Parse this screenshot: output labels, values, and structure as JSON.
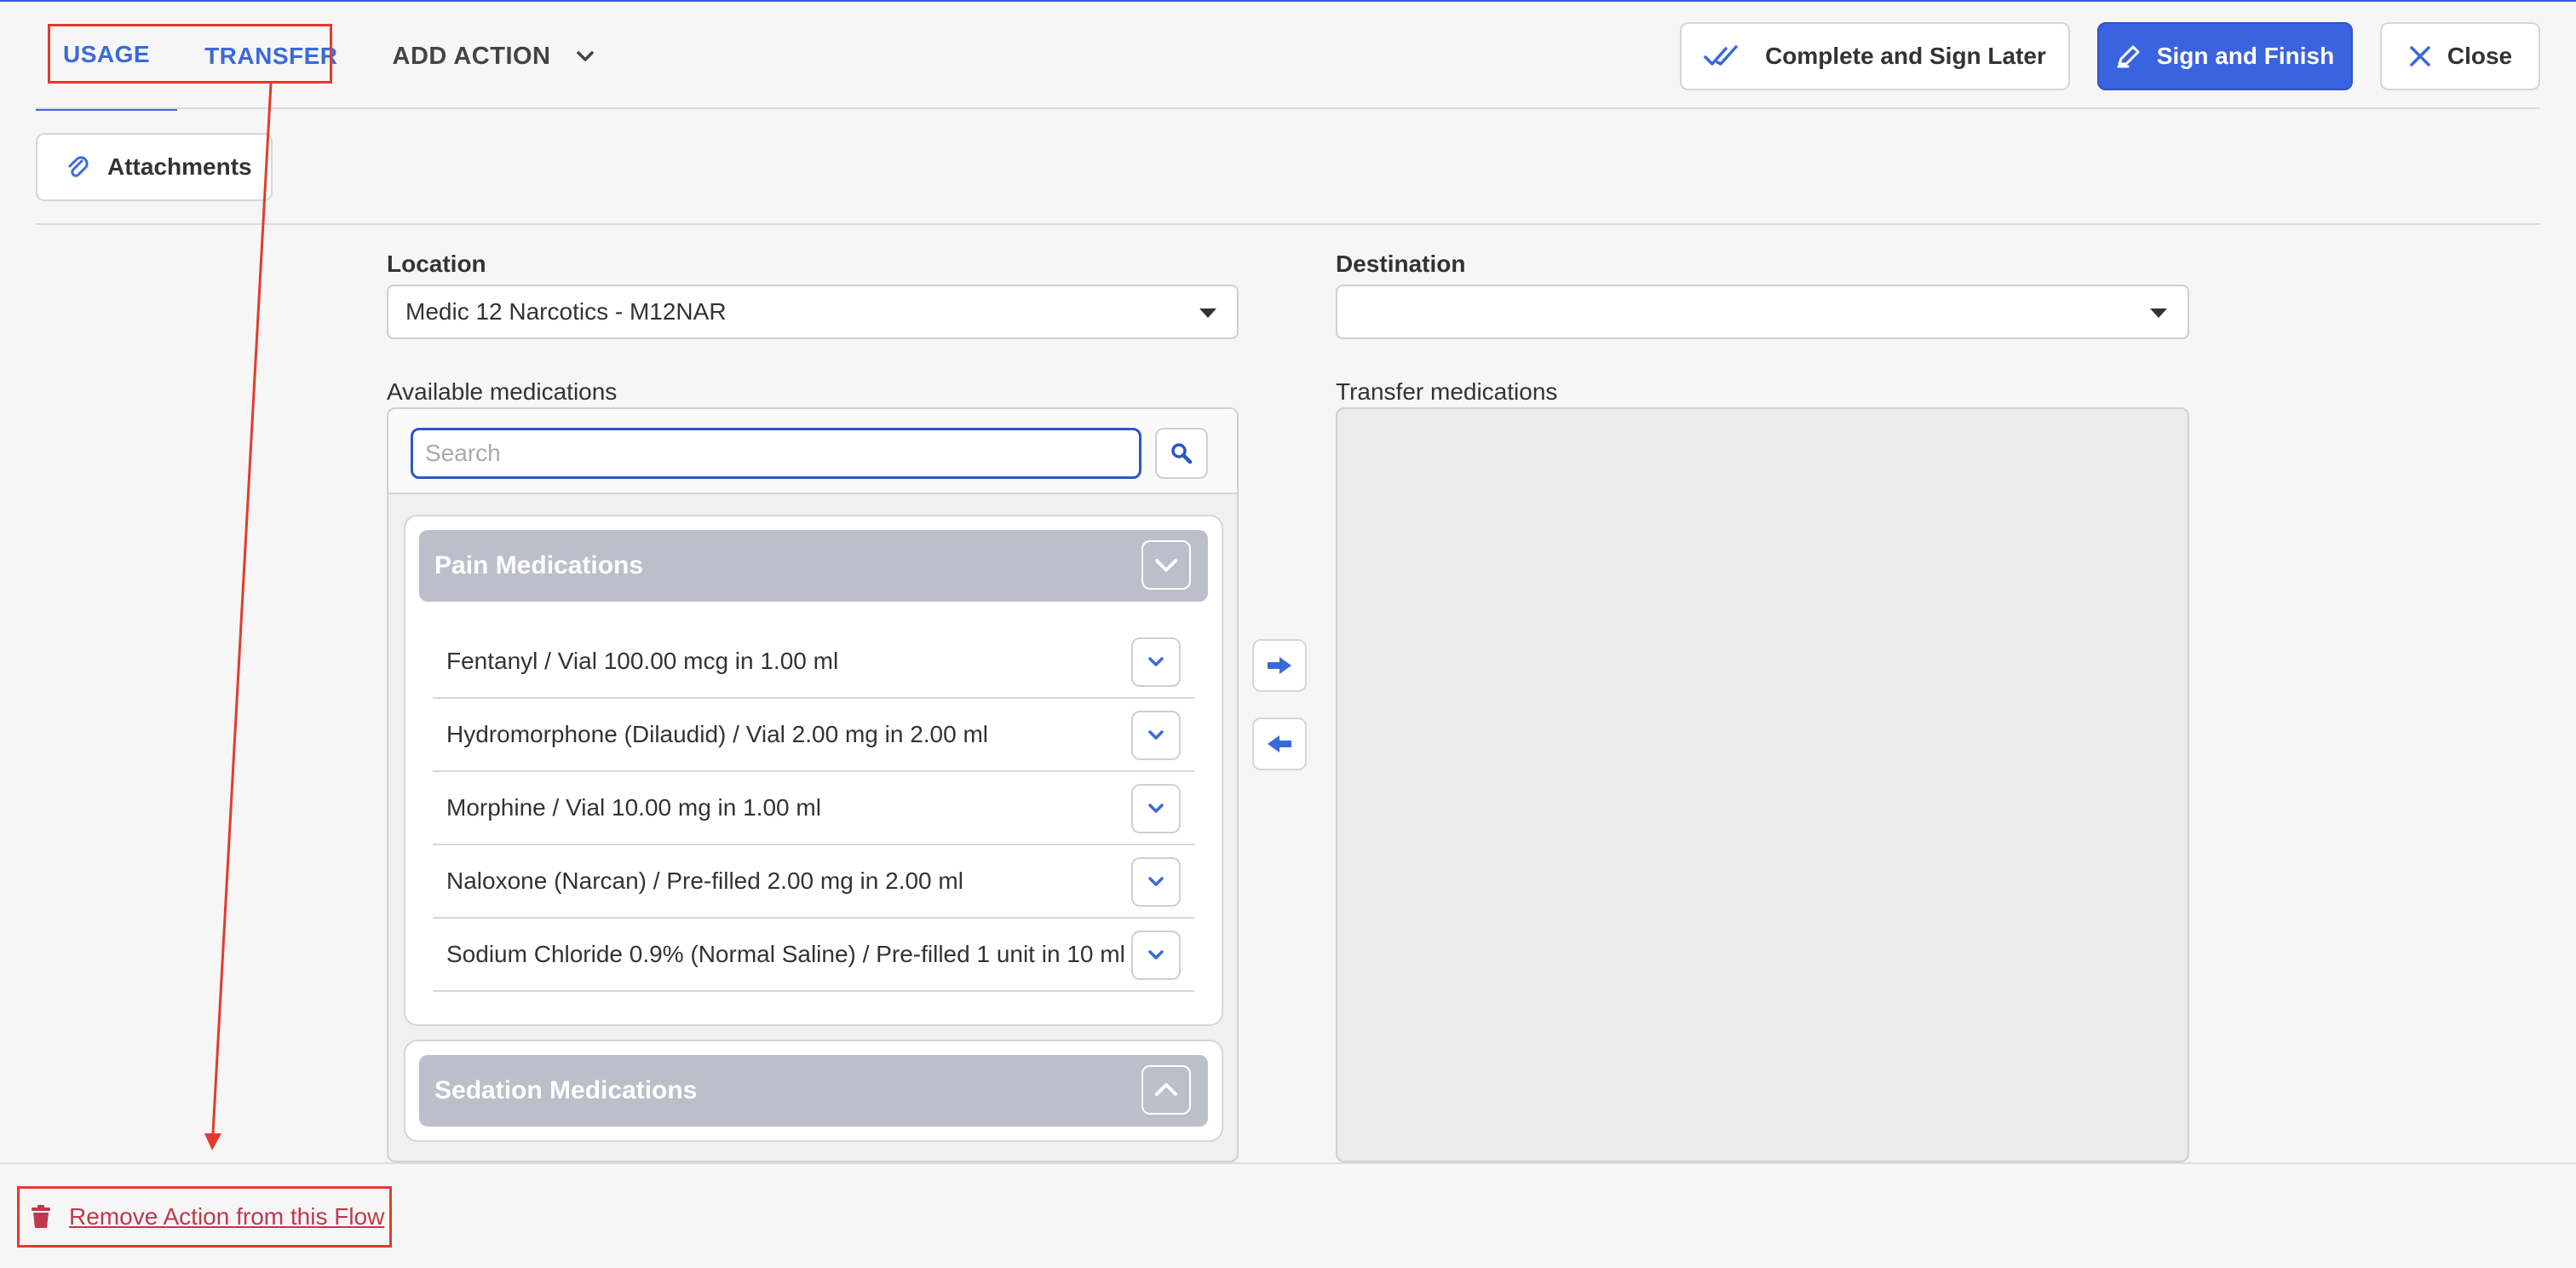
{
  "header": {
    "tabs": [
      {
        "label": "USAGE"
      },
      {
        "label": "TRANSFER"
      }
    ],
    "add_action_label": "ADD ACTION",
    "complete_later_label": "Complete and Sign Later",
    "sign_finish_label": "Sign and Finish",
    "close_label": "Close"
  },
  "attachments_label": "Attachments",
  "form": {
    "location_label": "Location",
    "location_value": "Medic 12 Narcotics - M12NAR",
    "destination_label": "Destination",
    "destination_value": "",
    "available_label": "Available medications",
    "transfer_label": "Transfer medications",
    "search_placeholder": "Search"
  },
  "groups": [
    {
      "title": "Pain Medications",
      "expanded": true,
      "items": [
        {
          "name": "Fentanyl / Vial 100.00 mcg in 1.00 ml"
        },
        {
          "name": "Hydromorphone (Dilaudid) / Vial 2.00 mg in 2.00 ml"
        },
        {
          "name": "Morphine / Vial 10.00 mg in 1.00 ml"
        },
        {
          "name": "Naloxone (Narcan) / Pre-filled 2.00 mg in 2.00 ml"
        },
        {
          "name": "Sodium Chloride 0.9% (Normal Saline) / Pre-filled 1 unit in 10 ml"
        }
      ]
    },
    {
      "title": "Sedation Medications",
      "expanded": false,
      "items": []
    }
  ],
  "footer": {
    "remove_label": "Remove Action from this Flow"
  },
  "colors": {
    "accent": "#3b6ad8",
    "primary_button": "#3a63e0",
    "annotation": "#e23b2e",
    "danger_text": "#c0394a"
  }
}
